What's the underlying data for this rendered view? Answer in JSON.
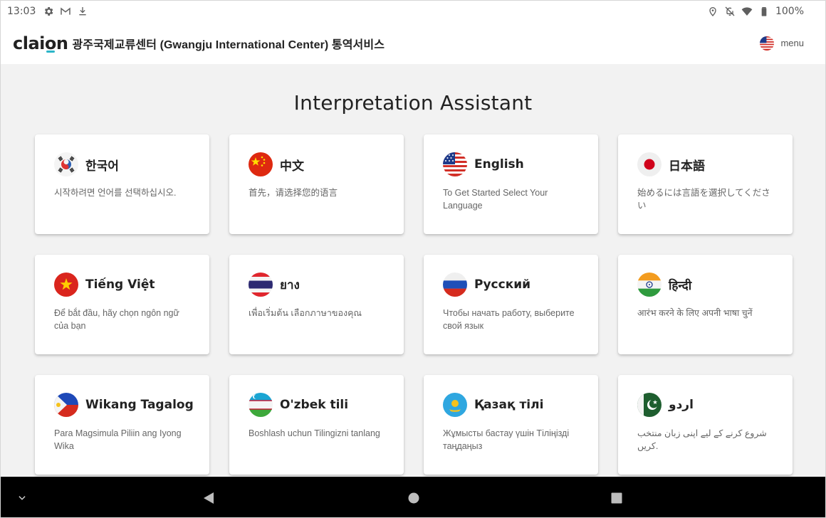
{
  "status_bar": {
    "time": "13:03",
    "left_icons": [
      "gear-icon",
      "gmail-icon",
      "download-icon"
    ],
    "right_icons": [
      "location-icon",
      "notifications-off-icon",
      "wifi-icon",
      "battery-icon"
    ],
    "battery": "100%"
  },
  "header": {
    "logo": "claion",
    "title": "광주국제교류센터 (Gwangju International Center) 통역서비스",
    "menu_label": "menu"
  },
  "main": {
    "title": "Interpretation Assistant",
    "languages": [
      {
        "name": "한국어",
        "prompt": "시작하려면 언어를 선택하십시오.",
        "flag": "korea-flag-icon"
      },
      {
        "name": "中文",
        "prompt": "首先，请选择您的语言",
        "flag": "china-flag-icon"
      },
      {
        "name": "English",
        "prompt": "To Get Started Select Your Language",
        "flag": "usa-flag-icon"
      },
      {
        "name": "日本語",
        "prompt": "始めるには言語を選択してください",
        "flag": "japan-flag-icon"
      },
      {
        "name": "Tiếng Việt",
        "prompt": "Để bắt đầu, hãy chọn ngôn ngữ của bạn",
        "flag": "vietnam-flag-icon"
      },
      {
        "name": "ยาง",
        "prompt": "เพื่อเริ่มต้น เลือกภาษาของคุณ",
        "flag": "thailand-flag-icon"
      },
      {
        "name": "Русский",
        "prompt": "Чтобы начать работу, выберите свой язык",
        "flag": "russia-flag-icon"
      },
      {
        "name": "हिन्दी",
        "prompt": "आरंभ करने के लिए अपनी भाषा चुनें",
        "flag": "india-flag-icon"
      },
      {
        "name": "Wikang Tagalog",
        "prompt": "Para Magsimula Piliin ang Iyong Wika",
        "flag": "philippines-flag-icon"
      },
      {
        "name": "O'zbek tili",
        "prompt": "Boshlash uchun Tilingizni tanlang",
        "flag": "uzbekistan-flag-icon"
      },
      {
        "name": "Қазақ тілі",
        "prompt": "Жұмысты бастау үшін Тіліңізді таңдаңыз",
        "flag": "kazakhstan-flag-icon"
      },
      {
        "name": "اردو",
        "prompt": "شروع کرنے کے لیے اپنی زبان منتخب کریں.",
        "flag": "pakistan-flag-icon"
      }
    ]
  },
  "nav_bar": {
    "buttons": [
      "chevron-down-icon",
      "back-icon",
      "home-icon",
      "recents-icon"
    ]
  }
}
